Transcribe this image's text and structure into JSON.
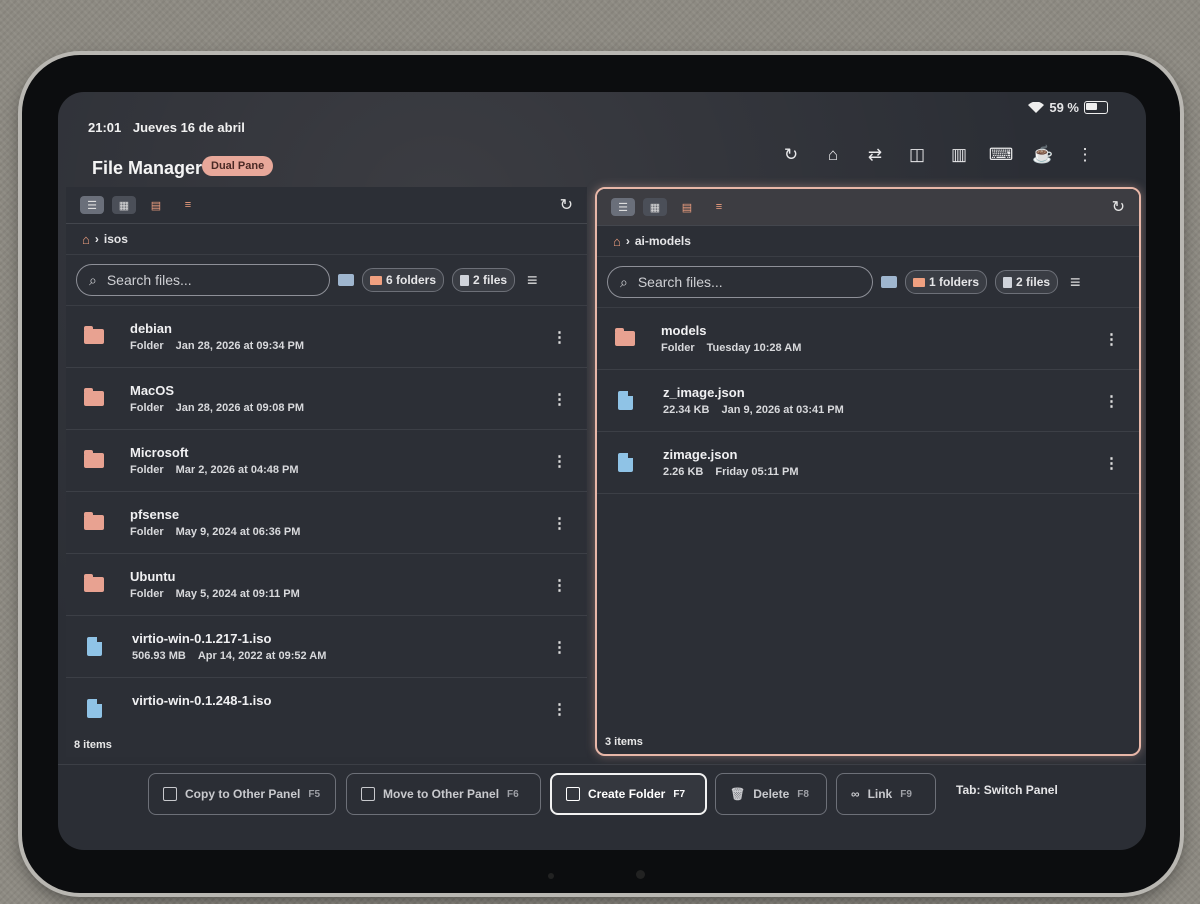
{
  "status": {
    "time": "21:01",
    "date": "Jueves 16 de abril",
    "battery": "59 %"
  },
  "app": {
    "title": "File Manager",
    "mode_badge": "Dual Pane"
  },
  "toolbar": [
    "refresh-icon",
    "home-icon",
    "swap-icon",
    "split-icon",
    "columns-icon",
    "keyboard-icon",
    "coffee-icon",
    "more-vert-icon"
  ],
  "left_pane": {
    "breadcrumb": "isos",
    "search_placeholder": "Search files...",
    "folders_chip": "6 folders",
    "files_chip": "2 files",
    "items": [
      {
        "name": "debian",
        "type": "Folder",
        "date": "Jan 28, 2026 at 09:34 PM",
        "kind": "folder"
      },
      {
        "name": "MacOS",
        "type": "Folder",
        "date": "Jan 28, 2026 at 09:08 PM",
        "kind": "folder"
      },
      {
        "name": "Microsoft",
        "type": "Folder",
        "date": "Mar 2, 2026 at 04:48 PM",
        "kind": "folder"
      },
      {
        "name": "pfsense",
        "type": "Folder",
        "date": "May 9, 2024 at 06:36 PM",
        "kind": "folder"
      },
      {
        "name": "Ubuntu",
        "type": "Folder",
        "date": "May 5, 2024 at 09:11 PM",
        "kind": "folder"
      },
      {
        "name": "virtio-win-0.1.217-1.iso",
        "type": "506.93 MB",
        "date": "Apr 14, 2022 at 09:52 AM",
        "kind": "file"
      },
      {
        "name": "virtio-win-0.1.248-1.iso",
        "type": "",
        "date": "",
        "kind": "file"
      }
    ],
    "count": "8 items"
  },
  "right_pane": {
    "breadcrumb": "ai-models",
    "search_placeholder": "Search files...",
    "folders_chip": "1 folders",
    "files_chip": "2 files",
    "items": [
      {
        "name": "models",
        "type": "Folder",
        "date": "Tuesday 10:28 AM",
        "kind": "folder"
      },
      {
        "name": "z_image.json",
        "type": "22.34 KB",
        "date": "Jan 9, 2026 at 03:41 PM",
        "kind": "file"
      },
      {
        "name": "zimage.json",
        "type": "2.26 KB",
        "date": "Friday 05:11 PM",
        "kind": "file"
      }
    ],
    "count": "3 items"
  },
  "actions": {
    "copy": "Copy to Other Panel",
    "copy_key": "F5",
    "move": "Move to Other Panel",
    "move_key": "F6",
    "create": "Create Folder",
    "create_key": "F7",
    "delete": "Delete",
    "delete_key": "F8",
    "link": "Link",
    "link_key": "F9",
    "tab_hint": "Tab: Switch Panel"
  },
  "colors": {
    "accent": "#e8a291",
    "file": "#8fc3e6",
    "bg": "#2b2e35"
  }
}
